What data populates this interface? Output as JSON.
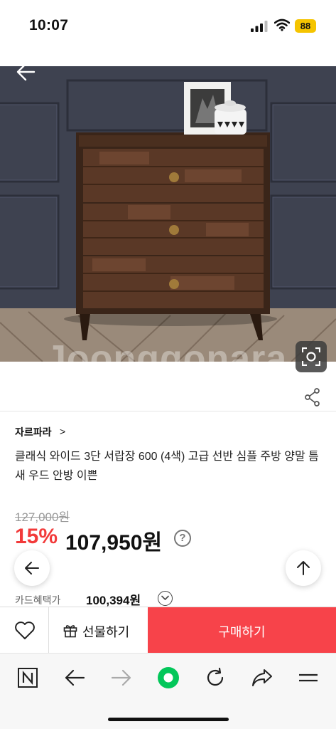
{
  "status_bar": {
    "time": "10:07",
    "battery": "88",
    "signal_icon": "cellular-signal-icon",
    "wifi_icon": "wifi-icon"
  },
  "hero": {
    "watermark": "Joonggonara",
    "back_icon": "arrow-left-icon",
    "lens_icon": "image-search-icon"
  },
  "share_icon": "share-icon",
  "product": {
    "seller": "자르파라",
    "seller_chevron": ">",
    "title": "클래식 와이드 3단 서랍장 600 (4색) 고급 선반 심플 주방 양말 틈새 우드 안방 이쁜",
    "original_price": "127,000원",
    "discount": "15%",
    "price": "107,950원",
    "price_help": "?",
    "card_label": "카드혜택가",
    "card_price": "100,394원"
  },
  "floating": {
    "back_icon": "arrow-left-icon",
    "top_icon": "arrow-up-icon"
  },
  "purchase_bar": {
    "wish_icon": "heart-icon",
    "gift_icon": "gift-icon",
    "gift_label": "선물하기",
    "buy_label": "구매하기",
    "buy_color": "#f7434a"
  },
  "browser_bar": {
    "items": [
      "naver-home-icon",
      "back-icon",
      "forward-icon",
      "green-dot-icon",
      "reload-icon",
      "share-icon",
      "menu-icon"
    ]
  },
  "colors": {
    "discount": "#f23a3a",
    "battery": "#f5c400",
    "naver_green": "#03c75a"
  }
}
